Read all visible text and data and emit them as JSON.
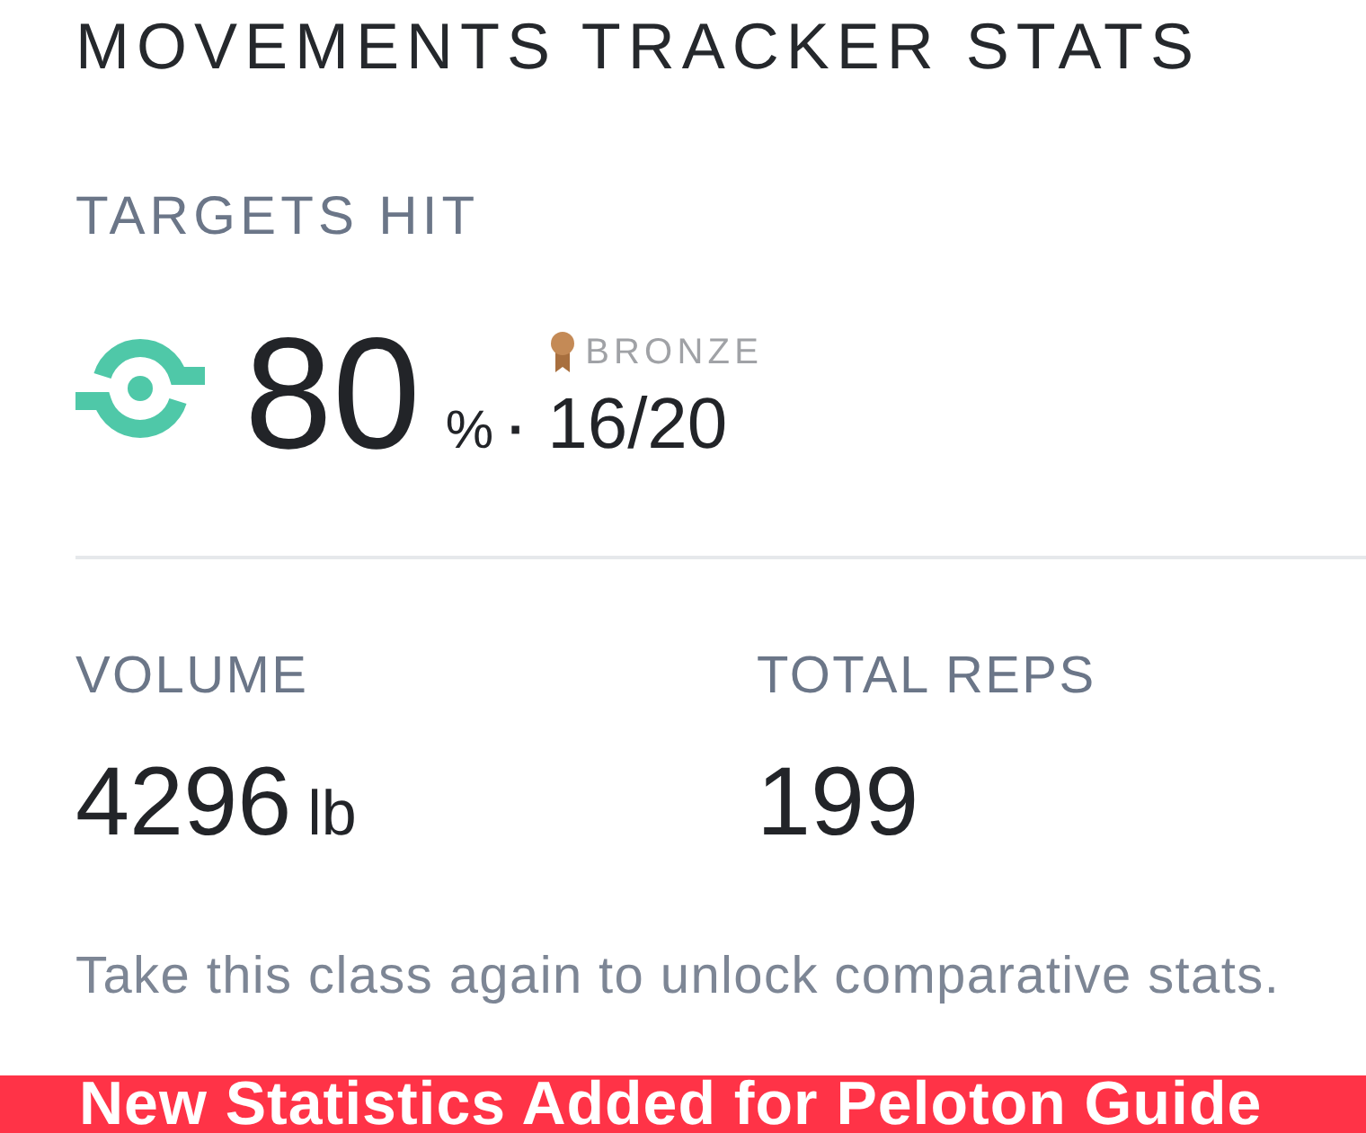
{
  "section": {
    "title": "MOVEMENTS TRACKER STATS"
  },
  "targets": {
    "label": "TARGETS HIT",
    "value": "80",
    "unit": "%",
    "separator": "·",
    "count": "16/20",
    "medal": {
      "kind": "bronze",
      "label": "BRONZE"
    }
  },
  "stats": [
    {
      "label": "VOLUME",
      "value": "4296",
      "unit": "lb"
    },
    {
      "label": "TOTAL REPS",
      "value": "199"
    }
  ],
  "note": "Take this class again to unlock comparative stats.",
  "banner": {
    "text": "New Statistics Added for Peloton Guide"
  }
}
